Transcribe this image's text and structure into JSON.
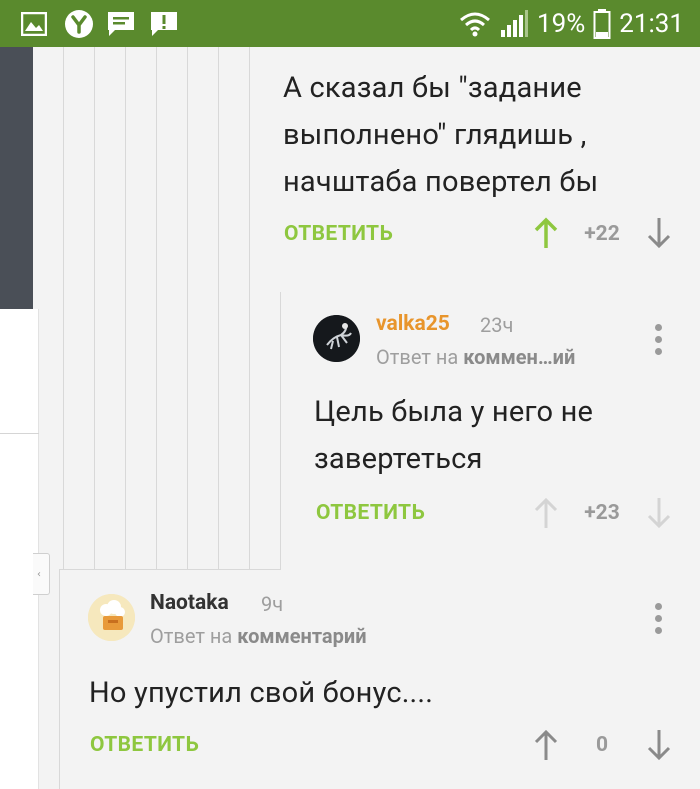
{
  "status_bar": {
    "battery": "19%",
    "time": "21:31",
    "icons": [
      "gallery-icon",
      "browser-y-icon",
      "message-icon",
      "notification-icon",
      "wifi-icon",
      "signal-icon",
      "battery-icon"
    ]
  },
  "colors": {
    "status_bar": "#5a8a2d",
    "reply_green": "#8ec73f",
    "upvote_active": "#8ec73f",
    "username_orange": "#e8952c",
    "username_dark": "#333333"
  },
  "comments": [
    {
      "text_lines": [
        "А сказал бы \"задание",
        "выполнено\" глядишь ,",
        "начштаба повертел бы"
      ],
      "reply_label": "ОТВЕТИТЬ",
      "score": "+22",
      "upvoted": true
    },
    {
      "username": "valka25",
      "time": "23ч",
      "reply_prefix": "Ответ на",
      "reply_target": "коммен…ий",
      "text_lines": [
        "Цель была у него не",
        "завертеться"
      ],
      "reply_label": "ОТВЕТИТЬ",
      "score": "+23"
    },
    {
      "username": "Naotaka",
      "time": "9ч",
      "reply_prefix": "Ответ на",
      "reply_target": "комментарий",
      "text_lines": [
        "Но упустил свой бонус...."
      ],
      "reply_label": "ОТВЕТИТЬ",
      "score": "0"
    }
  ]
}
